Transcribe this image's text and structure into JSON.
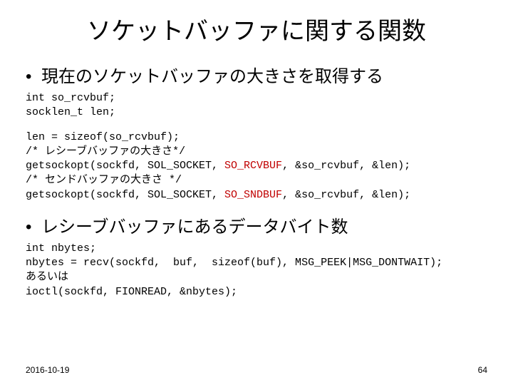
{
  "title": "ソケットバッファに関する関数",
  "bullet1": "現在のソケットバッファの大きさを取得する",
  "code1a": "int so_rcvbuf;\nsocklen_t len;",
  "code1b_l1": "len = sizeof(so_rcvbuf);",
  "code1b_l2": "/* レシーブバッファの大きさ*/",
  "code1b_l3a": "getsockopt(sockfd, SOL_SOCKET, ",
  "code1b_l3b": "SO_RCVBUF",
  "code1b_l3c": ", &so_rcvbuf, &len);",
  "code1b_l4": "/* センドバッファの大きさ */",
  "code1b_l5a": "getsockopt(sockfd, SOL_SOCKET, ",
  "code1b_l5b": "SO_SNDBUF",
  "code1b_l5c": ", &so_rcvbuf, &len);",
  "bullet2": "レシーブバッファにあるデータバイト数",
  "code2": "int nbytes;\nnbytes = recv(sockfd,  buf,  sizeof(buf), MSG_PEEK|MSG_DONTWAIT);\nあるいは\nioctl(sockfd, FIONREAD, &nbytes);",
  "date": "2016-10-19",
  "page": "64"
}
